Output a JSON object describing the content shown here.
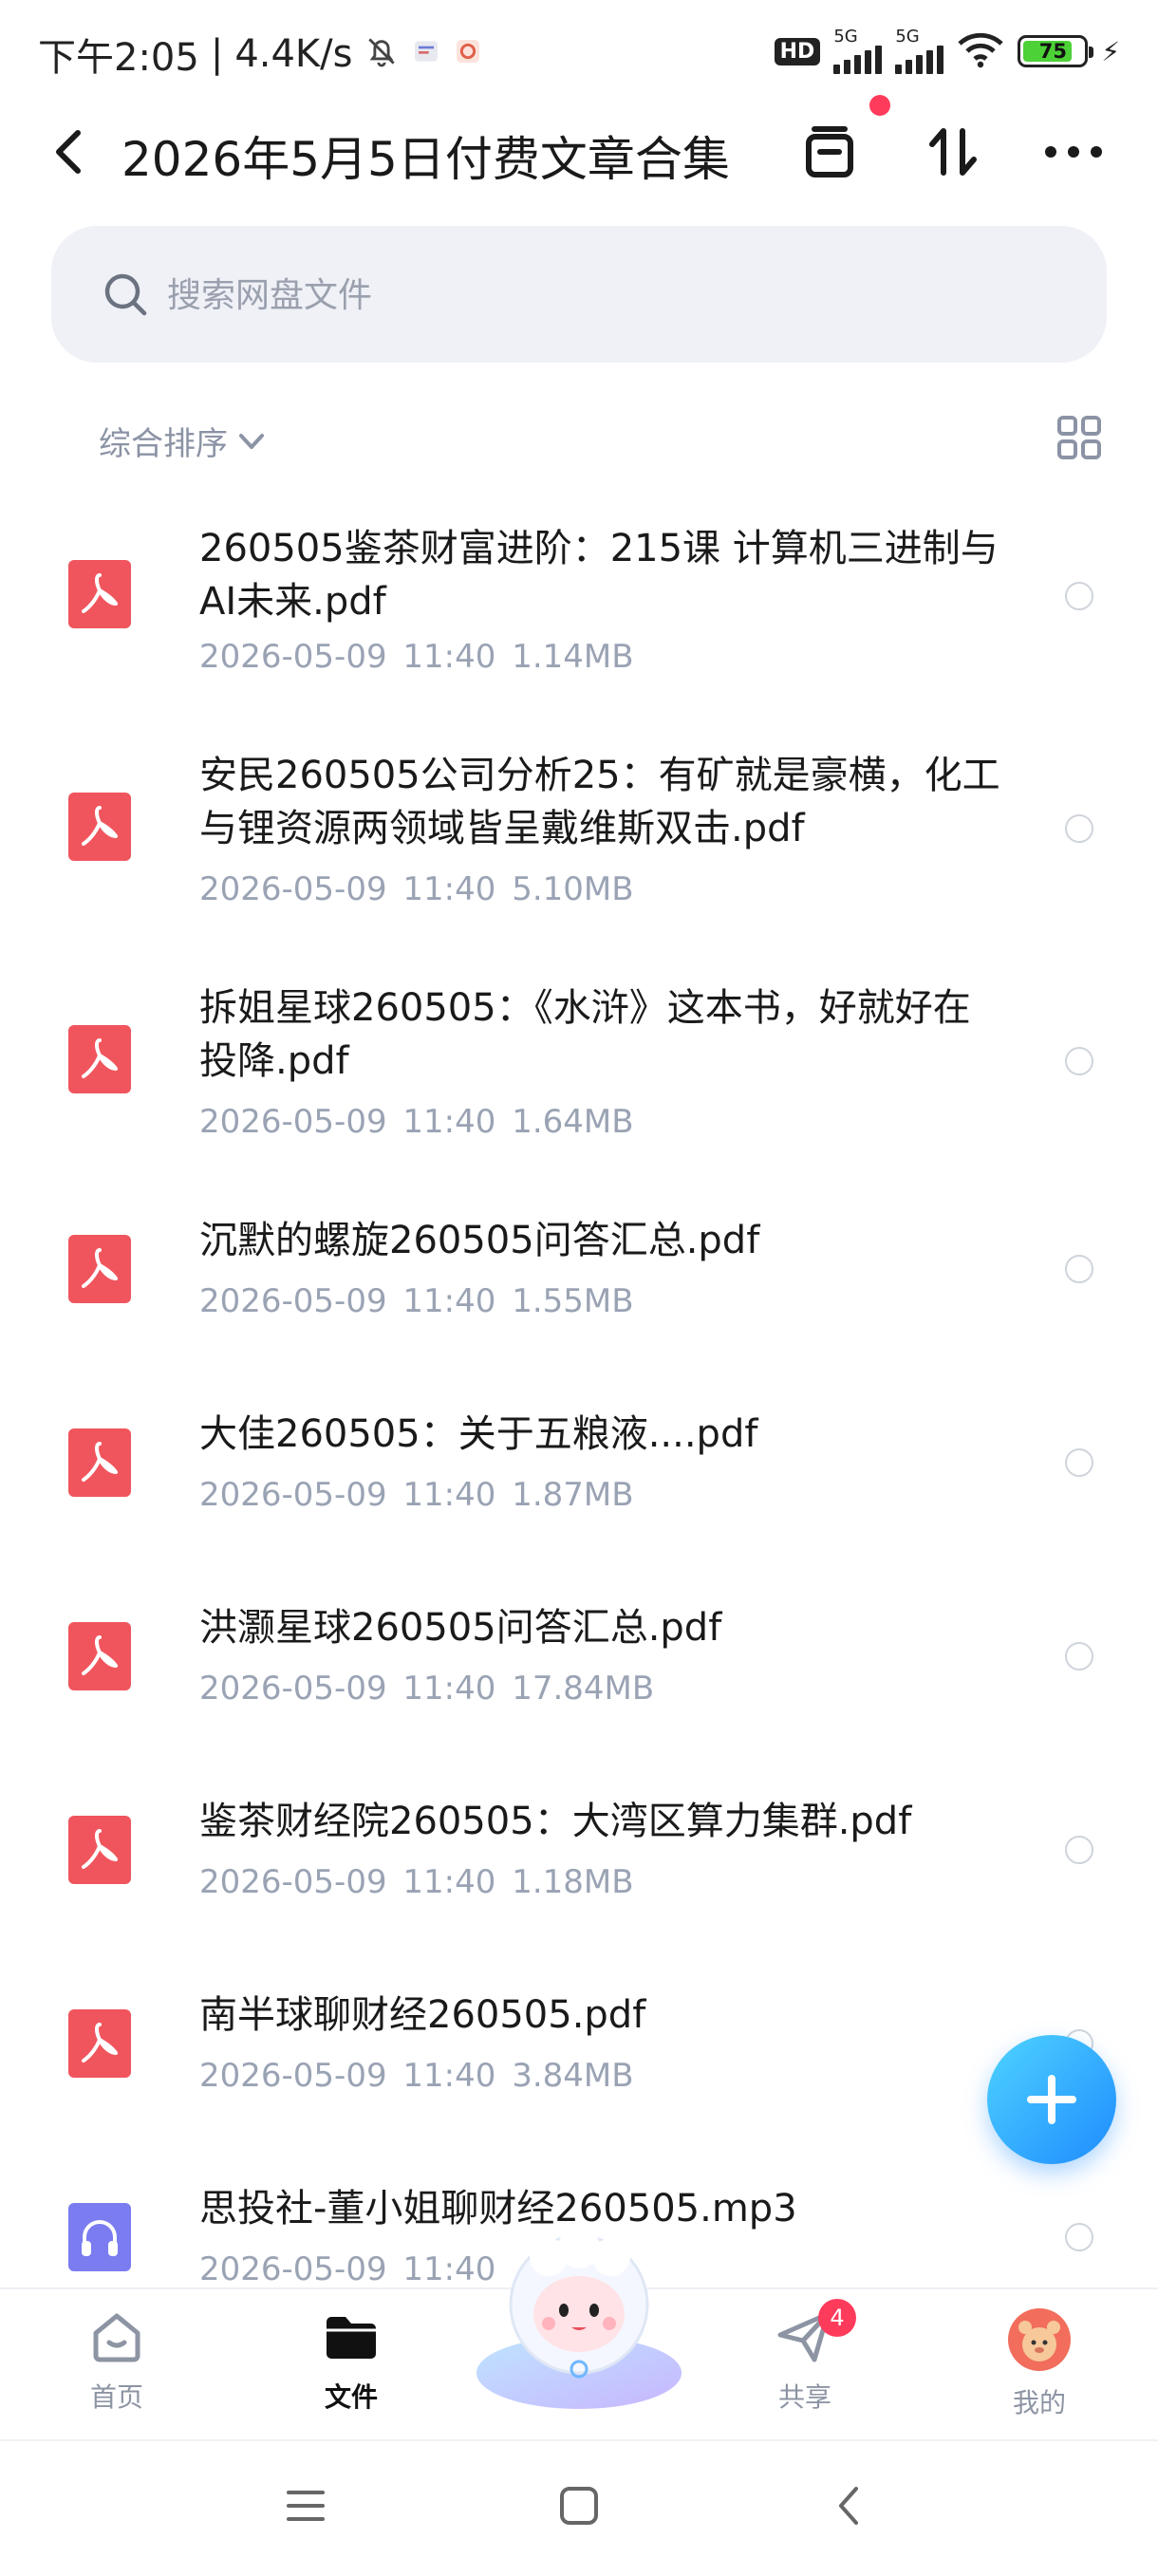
{
  "status_bar": {
    "time": "下午2:05",
    "separator": "|",
    "speed": "4.4K/s",
    "hd": "HD",
    "network_1": "5G",
    "network_2": "5G",
    "battery": "75"
  },
  "header": {
    "title": "2026年5月5日付费文章合集"
  },
  "search": {
    "placeholder": "搜索网盘文件"
  },
  "sort": {
    "label": "综合排序"
  },
  "files": [
    {
      "name": "260505鉴茶财富进阶：215课 计算机三进制与AI未来.pdf",
      "date": "2026-05-09",
      "time": "11:40",
      "size": "1.14MB",
      "type": "pdf"
    },
    {
      "name": "安民260505公司分析25：有矿就是豪横，化工与锂资源两领域皆呈戴维斯双击.pdf",
      "date": "2026-05-09",
      "time": "11:40",
      "size": "5.10MB",
      "type": "pdf"
    },
    {
      "name": "拆姐星球260505：《水浒》这本书，好就好在投降.pdf",
      "date": "2026-05-09",
      "time": "11:40",
      "size": "1.64MB",
      "type": "pdf"
    },
    {
      "name": "沉默的螺旋260505问答汇总.pdf",
      "date": "2026-05-09",
      "time": "11:40",
      "size": "1.55MB",
      "type": "pdf"
    },
    {
      "name": "大佳260505：关于五粮液....pdf",
      "date": "2026-05-09",
      "time": "11:40",
      "size": "1.87MB",
      "type": "pdf"
    },
    {
      "name": "洪灏星球260505问答汇总.pdf",
      "date": "2026-05-09",
      "time": "11:40",
      "size": "17.84MB",
      "type": "pdf"
    },
    {
      "name": "鉴茶财经院260505：大湾区算力集群.pdf",
      "date": "2026-05-09",
      "time": "11:40",
      "size": "1.18MB",
      "type": "pdf"
    },
    {
      "name": "南半球聊财经260505.pdf",
      "date": "2026-05-09",
      "time": "11:40",
      "size": "3.84MB",
      "type": "pdf"
    },
    {
      "name": "思投社-董小姐聊财经260505.mp3",
      "date": "2026-05-09",
      "time": "11:40",
      "size": "",
      "type": "audio"
    }
  ],
  "bottom_nav": {
    "home": "首页",
    "files": "文件",
    "share": "共享",
    "share_badge": "4",
    "me": "我的"
  },
  "colors": {
    "pdf_icon": "#f0555d",
    "audio_icon": "#7a7cf0",
    "fab": "#1e8cff",
    "badge": "#ff3b5c"
  }
}
